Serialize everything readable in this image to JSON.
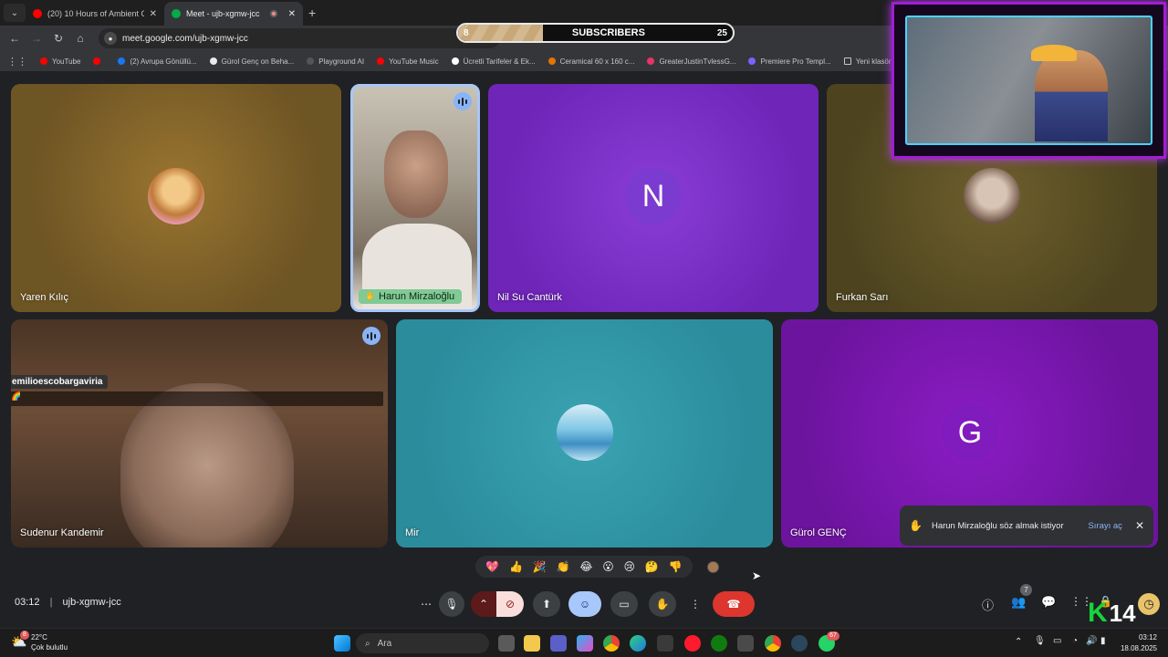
{
  "browser": {
    "tabs": [
      {
        "title": "(20) 10 Hours of Ambient City...",
        "favicon_color": "#ff0000",
        "active": false
      },
      {
        "title": "Meet - ujb-xgmw-jcc",
        "favicon_color": "#00ac47",
        "active": true
      }
    ],
    "url": "meet.google.com/ujb-xgmw-jcc",
    "bookmarks": [
      {
        "label": "YouTube",
        "color": "#ff0000"
      },
      {
        "label": "",
        "color": "#ff0000"
      },
      {
        "label": "(2) Avrupa Gönüllü...",
        "color": "#1877f2"
      },
      {
        "label": "Gürol Genç on Beha...",
        "color": "#e8eaed"
      },
      {
        "label": "Playground AI",
        "color": "#555555"
      },
      {
        "label": "YouTube Music",
        "color": "#ff0000"
      },
      {
        "label": "Ücretli Tarifeler & Ek...",
        "color": "#ffffff"
      },
      {
        "label": "Ceramical 60 x 160 c...",
        "color": "#e37400"
      },
      {
        "label": "GreaterJustinTvlessG...",
        "color": "#e8336b"
      },
      {
        "label": "Premiere Pro Templ...",
        "color": "#7b61ff"
      },
      {
        "label": "Yeni klasör",
        "color": "#c4c7c5"
      },
      {
        "label": "De",
        "color": "#9b59b6"
      }
    ]
  },
  "overlay": {
    "subscribers_label": "SUBSCRIBERS",
    "current": "8",
    "goal": "25",
    "progress": 0.31
  },
  "participants": [
    {
      "name": "Yaren Kılıç",
      "type": "avatar-image"
    },
    {
      "name": "Harun Mirzaloğlu",
      "type": "video",
      "hand_raised": true
    },
    {
      "name": "Nil Su Cantürk",
      "type": "initial",
      "initial": "N",
      "color": "#7b2fc9"
    },
    {
      "name": "Furkan Sarı",
      "type": "avatar-image"
    },
    {
      "name": "Sudenur Kandemir",
      "type": "video",
      "overlay_user": "emilioescobargaviria"
    },
    {
      "name": "Mir",
      "type": "avatar-image"
    },
    {
      "name": "Gürol GENÇ",
      "type": "initial",
      "initial": "G",
      "color": "#7a16b0"
    }
  ],
  "reactions": [
    "💖",
    "👍",
    "🎉",
    "👏",
    "😂",
    "😮",
    "😢",
    "🤔",
    "👎"
  ],
  "toast": {
    "message": "Harun Mirzaloğlu söz almak istiyor",
    "action": "Sırayı aç"
  },
  "meeting": {
    "time": "03:12",
    "code": "ujb-xgmw-jcc",
    "people_count": "7"
  },
  "taskbar": {
    "weather_temp": "22°C",
    "weather_desc": "Çok bulutlu",
    "weather_badge": "8",
    "search_placeholder": "Ara",
    "clock_time": "03:12",
    "clock_date": "18.08.2025",
    "whatsapp_badge": "67"
  },
  "stream_badge": "14"
}
